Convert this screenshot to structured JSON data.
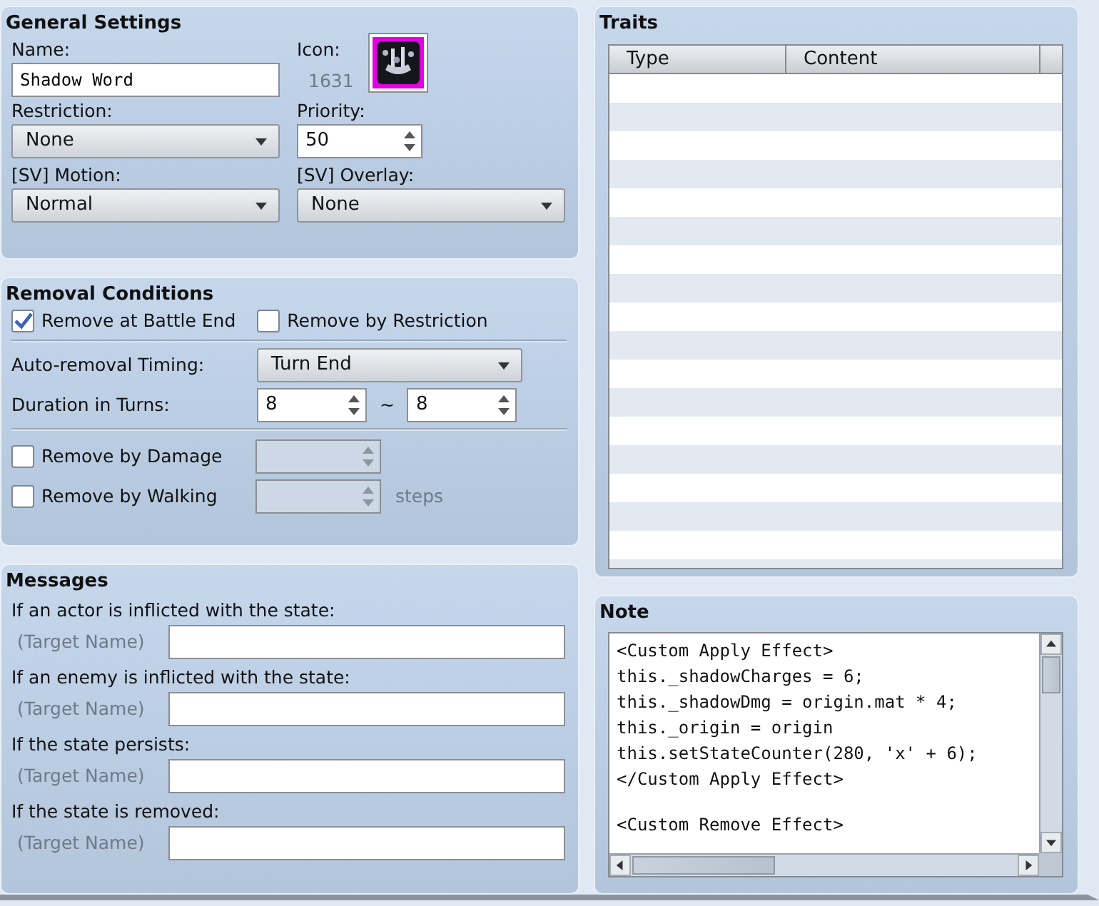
{
  "general_settings": {
    "title": "General Settings",
    "name": {
      "label": "Name:",
      "value": "Shadow Word"
    },
    "icon": {
      "label": "Icon:",
      "number": "1631"
    },
    "restriction": {
      "label": "Restriction:",
      "value": "None"
    },
    "priority": {
      "label": "Priority:",
      "value": "50"
    },
    "sv_motion": {
      "label": "[SV] Motion:",
      "value": "Normal"
    },
    "sv_overlay": {
      "label": "[SV] Overlay:",
      "value": "None"
    }
  },
  "removal_conditions": {
    "title": "Removal Conditions",
    "checkboxes": [
      {
        "label": "Remove at Battle End",
        "checked": true
      },
      {
        "label": "Remove by Restriction",
        "checked": false
      }
    ],
    "timing": {
      "label": "Auto-removal Timing:",
      "value": "Turn End"
    },
    "duration": {
      "label": "Duration in Turns:",
      "min": "8",
      "separator": "~",
      "max": "8"
    },
    "extra": [
      {
        "label": "Remove by Damage",
        "checked": false,
        "disabled": true
      },
      {
        "label": "Remove by Walking",
        "checked": false,
        "disabled": true,
        "unit": "steps"
      }
    ]
  },
  "messages": {
    "title": "Messages",
    "items": [
      {
        "label": "If an actor is inflicted with the state:",
        "prefix": "(Target Name)"
      },
      {
        "label": "If an enemy is inflicted with the state:",
        "prefix": "(Target Name)"
      },
      {
        "label": "If the state persists:",
        "prefix": "(Target Name)"
      },
      {
        "label": "If the state is removed:",
        "prefix": "(Target Name)"
      }
    ]
  },
  "traits": {
    "title": "Traits",
    "columns": [
      "Type",
      "Content"
    ]
  },
  "note": {
    "title": "Note",
    "blocks": [
      [
        "<Custom Apply Effect>",
        "this._shadowCharges = 6;",
        "this._shadowDmg = origin.mat * 4;",
        "this._origin = origin",
        "this.setStateCounter(280, 'x' + 6);",
        "</Custom Apply Effect>"
      ],
      [
        "<Custom Remove Effect>"
      ]
    ]
  }
}
